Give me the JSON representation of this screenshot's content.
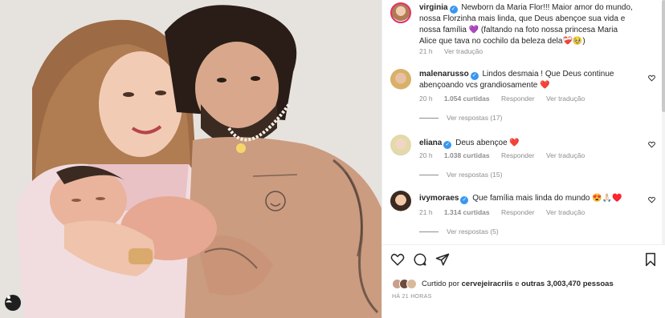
{
  "post": {
    "author": "virginia",
    "caption": "Newborn da Maria Flor!!! Maior amor do mundo, nossa Florzinha mais linda, que Deus abençoe sua vida e nossa família 💜 (faltando na foto nossa princesa Maria Alice que tava no cochilo da beleza dela❤️‍🩹🥹)",
    "time": "21 h",
    "translate": "Ver tradução"
  },
  "comments": [
    {
      "username": "malenarusso",
      "text": "Lindos desmaia ! Que Deus continue abençoando vcs grandiosamente ❤️",
      "time": "20 h",
      "likes": "1.054 curtidas",
      "reply": "Responder",
      "translate": "Ver tradução",
      "view_replies": "Ver respostas (17)"
    },
    {
      "username": "eliana",
      "text": "Deus abençoe ❤️",
      "time": "20 h",
      "likes": "1.038 curtidas",
      "reply": "Responder",
      "translate": "Ver tradução",
      "view_replies": "Ver respostas (15)"
    },
    {
      "username": "ivymoraes",
      "text": "Que família mais linda do mundo 😍🙏🏻♥️",
      "time": "21 h",
      "likes": "1.314 curtidas",
      "reply": "Responder",
      "translate": "Ver tradução",
      "view_replies": "Ver respostas (5)"
    }
  ],
  "likes_summary": {
    "prefix": "Curtido por",
    "user": "cervejeiracriis",
    "middle": "e",
    "others": "outras 3,003,470 pessoas"
  },
  "timestamp": "HÁ 21 HORAS",
  "icons": {
    "like": "heart-outline-icon",
    "comment": "comment-bubble-icon",
    "share": "paper-plane-icon",
    "save": "bookmark-icon",
    "tag": "person-tag-icon"
  },
  "colors": {
    "verified": "#3897f0",
    "muted": "#8e8e8e",
    "text": "#262626",
    "heart": "#ed1c24"
  }
}
